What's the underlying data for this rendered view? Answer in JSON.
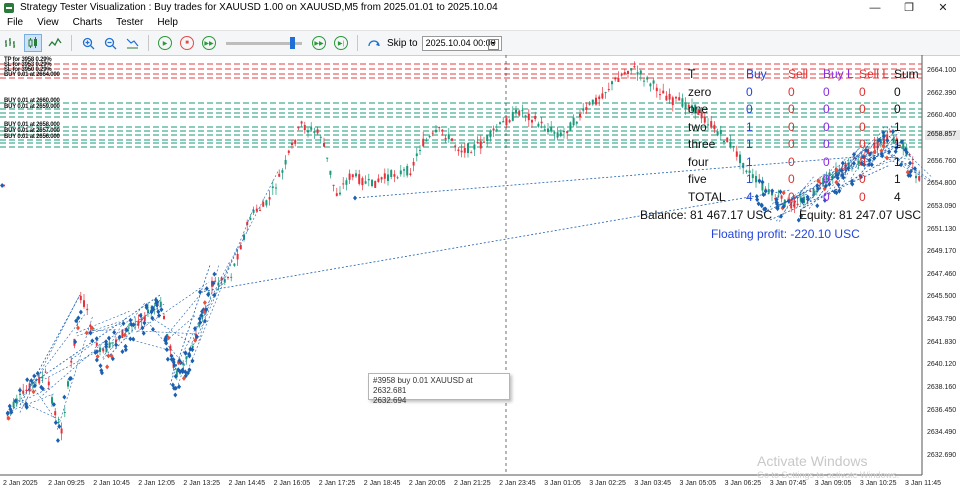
{
  "window": {
    "title": "Strategy Tester Visualization : Buy trades for XAUUSD 1.00 on XAUUSD,M5 from 2025.01.01 to 2025.10.04",
    "minimize": "—",
    "maximize": "❐",
    "close": "✕"
  },
  "menu": {
    "file": "File",
    "view": "View",
    "charts": "Charts",
    "tester": "Tester",
    "help": "Help"
  },
  "toolbar": {
    "skip_to_label": "Skip to",
    "skip_to_value": "2025.10.04 00:00",
    "speed_fraction": 0.9
  },
  "price_axis": {
    "labels": [
      "2664.100",
      "2662.390",
      "2660.400",
      "2658.720",
      "2656.760",
      "2654.800",
      "2653.090",
      "2651.130",
      "2649.170",
      "2647.460",
      "2645.500",
      "2643.790",
      "2641.830",
      "2640.120",
      "2638.160",
      "2636.450",
      "2634.490",
      "2632.690"
    ],
    "current_price": "2658.857"
  },
  "time_axis": {
    "labels": [
      "2 Jan 2025",
      "2 Jan 09:25",
      "2 Jan 10:45",
      "2 Jan 12:05",
      "2 Jan 13:25",
      "2 Jan 14:45",
      "2 Jan 16:05",
      "2 Jan 17:25",
      "2 Jan 18:45",
      "2 Jan 20:05",
      "2 Jan 21:25",
      "2 Jan 23:45",
      "3 Jan 01:05",
      "3 Jan 02:25",
      "3 Jan 03:45",
      "3 Jan 05:05",
      "3 Jan 06:25",
      "3 Jan 07:45",
      "3 Jan 09:05",
      "3 Jan 10:25",
      "3 Jan 11:45"
    ]
  },
  "order_labels": [
    "TP for 3958 0.29%",
    "SL for 3953 0.29%",
    "SL for 3950 0.29%",
    "BUY 0.01 at 2664.000",
    "BUY 0.01 at 2660.000",
    "BUY 0.01 at 2659.000",
    "BUY 0.01 at 2658.000",
    "BUY 0.01 at 2657.000",
    "BUY 0.01 at 2656.000"
  ],
  "stats_table": {
    "headers": [
      "T",
      "Buy",
      "Sell",
      "Buy L",
      "Sell L",
      "Sum"
    ],
    "rows": [
      [
        "zero",
        "0",
        "0",
        "0",
        "0",
        "0"
      ],
      [
        "one",
        "0",
        "0",
        "0",
        "0",
        "0"
      ],
      [
        "two",
        "1",
        "0",
        "0",
        "0",
        "1"
      ],
      [
        "three",
        "1",
        "0",
        "0",
        "0",
        "1"
      ],
      [
        "four",
        "1",
        "0",
        "0",
        "0",
        "1"
      ],
      [
        "five",
        "1",
        "0",
        "0",
        "0",
        "1"
      ],
      [
        "TOTAL",
        "4",
        "0",
        "0",
        "0",
        "4"
      ]
    ],
    "balance": "Balance: 81 467.17 USC",
    "equity": "Equity: 81 247.07 USC",
    "floating": "Floating profit:    -220.10 USC",
    "colors": {
      "label": "#111111",
      "buy": "#2244dd",
      "sell": "#e03030",
      "buy_l": "#8a2be2",
      "sell_l": "#e03030",
      "sum": "#111111",
      "floating": "#2244dd"
    }
  },
  "tooltip": {
    "line1": "#3958 buy 0.01 XAUUSD at 2632.681",
    "line2": "2632.694"
  },
  "watermark": {
    "title": "Activate Windows",
    "subtitle": "Go to Settings to activate Windows."
  },
  "colors": {
    "bull": "#1a9a7a",
    "bear": "#e8303a",
    "arrow_buy": "#1b5fb0",
    "arrow_sell": "#e8503a",
    "dash_red": "#e04040",
    "dash_green": "#1a9a7a"
  }
}
